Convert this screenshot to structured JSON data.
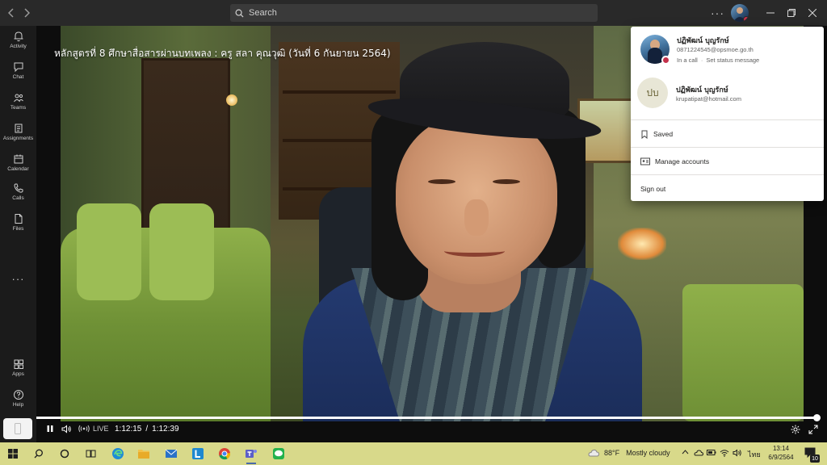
{
  "titlebar": {
    "search_placeholder": "Search",
    "more_label": "···",
    "window_controls": [
      "minimize-icon",
      "restore-icon",
      "close-icon"
    ]
  },
  "rail": {
    "items": [
      {
        "label": "Activity",
        "icon": "bell-icon"
      },
      {
        "label": "Chat",
        "icon": "chat-icon"
      },
      {
        "label": "Teams",
        "icon": "teams-icon"
      },
      {
        "label": "Assignments",
        "icon": "assignments-icon"
      },
      {
        "label": "Calendar",
        "icon": "calendar-icon"
      },
      {
        "label": "Calls",
        "icon": "phone-icon"
      },
      {
        "label": "Files",
        "icon": "file-icon"
      }
    ],
    "more": "···",
    "bottom_items": [
      {
        "label": "Apps",
        "icon": "apps-icon"
      },
      {
        "label": "Help",
        "icon": "help-icon"
      }
    ]
  },
  "video": {
    "title": "หลักสูตรที่ 8 ศึกษาสื่อสารผ่านบทเพลง : ครู สลา คุณวุฒิ (วันที่ 6 กันยายน 2564)",
    "live_label": "LIVE",
    "current_time": "1:12:15",
    "time_separator": "/",
    "total_time": "1:12:39",
    "progress": 0.995
  },
  "account_menu": {
    "primary": {
      "name": "ปฏิพัฒน์ บุญรักษ์",
      "email": "0871224545@opsmoe.go.th",
      "status": "In a call",
      "status_action": "Set status message",
      "status_color": "#c4314b"
    },
    "secondary": {
      "initials": "ปบ",
      "name": "ปฏิพัฒน์ บุญรักษ์",
      "email": "krupatipat@hotmail.com"
    },
    "items": [
      {
        "label": "Saved",
        "icon": "bookmark-icon"
      },
      {
        "label": "Manage accounts",
        "icon": "id-card-icon"
      },
      {
        "label": "Sign out",
        "icon": ""
      }
    ]
  },
  "taskbar": {
    "weather_temp": "88°F",
    "weather_text": "Mostly cloudy",
    "lang": "ไทย",
    "time": "13:14",
    "date": "6/9/2564",
    "notification_count": "10"
  },
  "colors": {
    "accent": "#6264a7",
    "taskbar": "#d8d98a",
    "busy": "#c4314b"
  }
}
